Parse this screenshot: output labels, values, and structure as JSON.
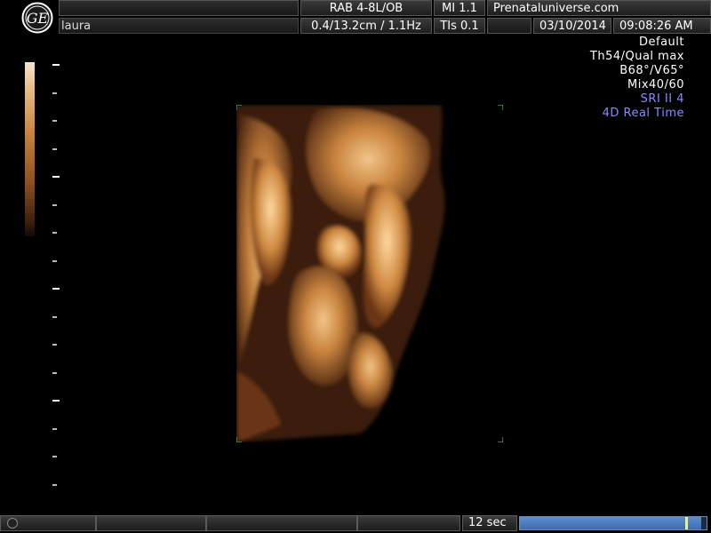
{
  "header": {
    "probe": "RAB 4-8L/OB",
    "mi": "MI  1.1",
    "website": "Prenataluniverse.com",
    "patient": "laura",
    "depth_freq": "0.4/13.2cm / 1.1Hz",
    "tis": "TIs  0.1",
    "date": "03/10/2014",
    "time": "09:08:26 AM"
  },
  "info": {
    "preset": "Default",
    "threshold": "Th54/Qual max",
    "angles": "B68°/V65°",
    "mix": "Mix40/60",
    "sri": "SRI II 4",
    "mode": "4D Real Time"
  },
  "footer": {
    "timer": "12 sec",
    "cine_progress": 0.97
  },
  "colors": {
    "accent_text": "#8a8aff",
    "render_tint": "#c9843e",
    "frame_corner": "#3c9c3c",
    "progress": "#4a7cc0"
  },
  "icons": {
    "logo": "ge-logo-icon"
  }
}
